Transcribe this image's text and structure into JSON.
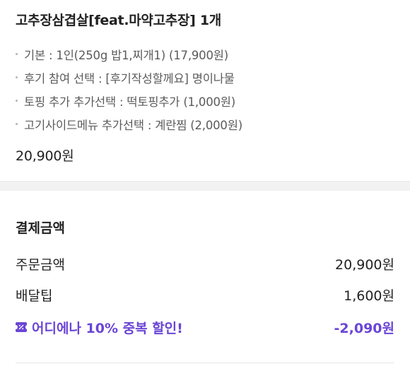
{
  "order_item": {
    "title": "고추장삼겹살[feat.마약고추장] 1개",
    "options": [
      "기본 : 1인(250g 밥1,찌개1) (17,900원)",
      "후기 참여 선택 : [후기작성할께요] 명이나물",
      "토핑 추가 추가선택 : 떡토핑추가 (1,000원)",
      "고기사이드메뉴 추가선택 : 계란찜 (2,000원)"
    ],
    "price": "20,900원"
  },
  "payment": {
    "title": "결제금액",
    "rows": [
      {
        "label": "주문금액",
        "value": "20,900원"
      },
      {
        "label": "배달팁",
        "value": "1,600원"
      }
    ],
    "discount": {
      "icon": "ticket-icon",
      "label": "어디에나 10% 중복 할인!",
      "value": "-2,090원",
      "color": "#6a45d6"
    }
  }
}
